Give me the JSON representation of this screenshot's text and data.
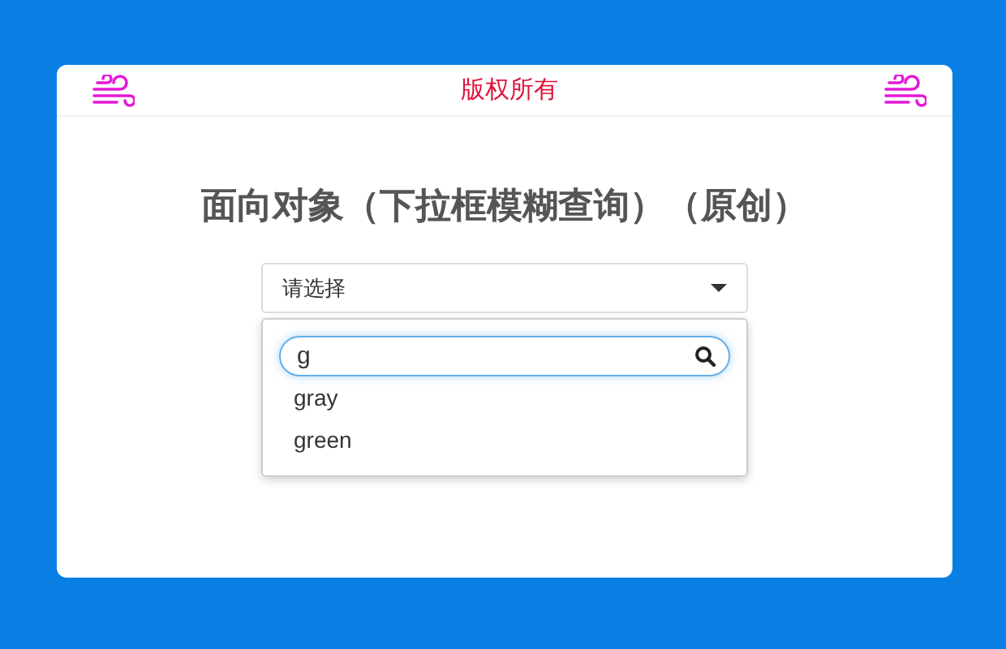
{
  "header": {
    "title": "版权所有"
  },
  "heading": "面向对象（下拉框模糊查询）（原创）",
  "select": {
    "value": "请选择"
  },
  "search": {
    "value": "g"
  },
  "options": [
    {
      "label": "gray"
    },
    {
      "label": "green"
    }
  ]
}
